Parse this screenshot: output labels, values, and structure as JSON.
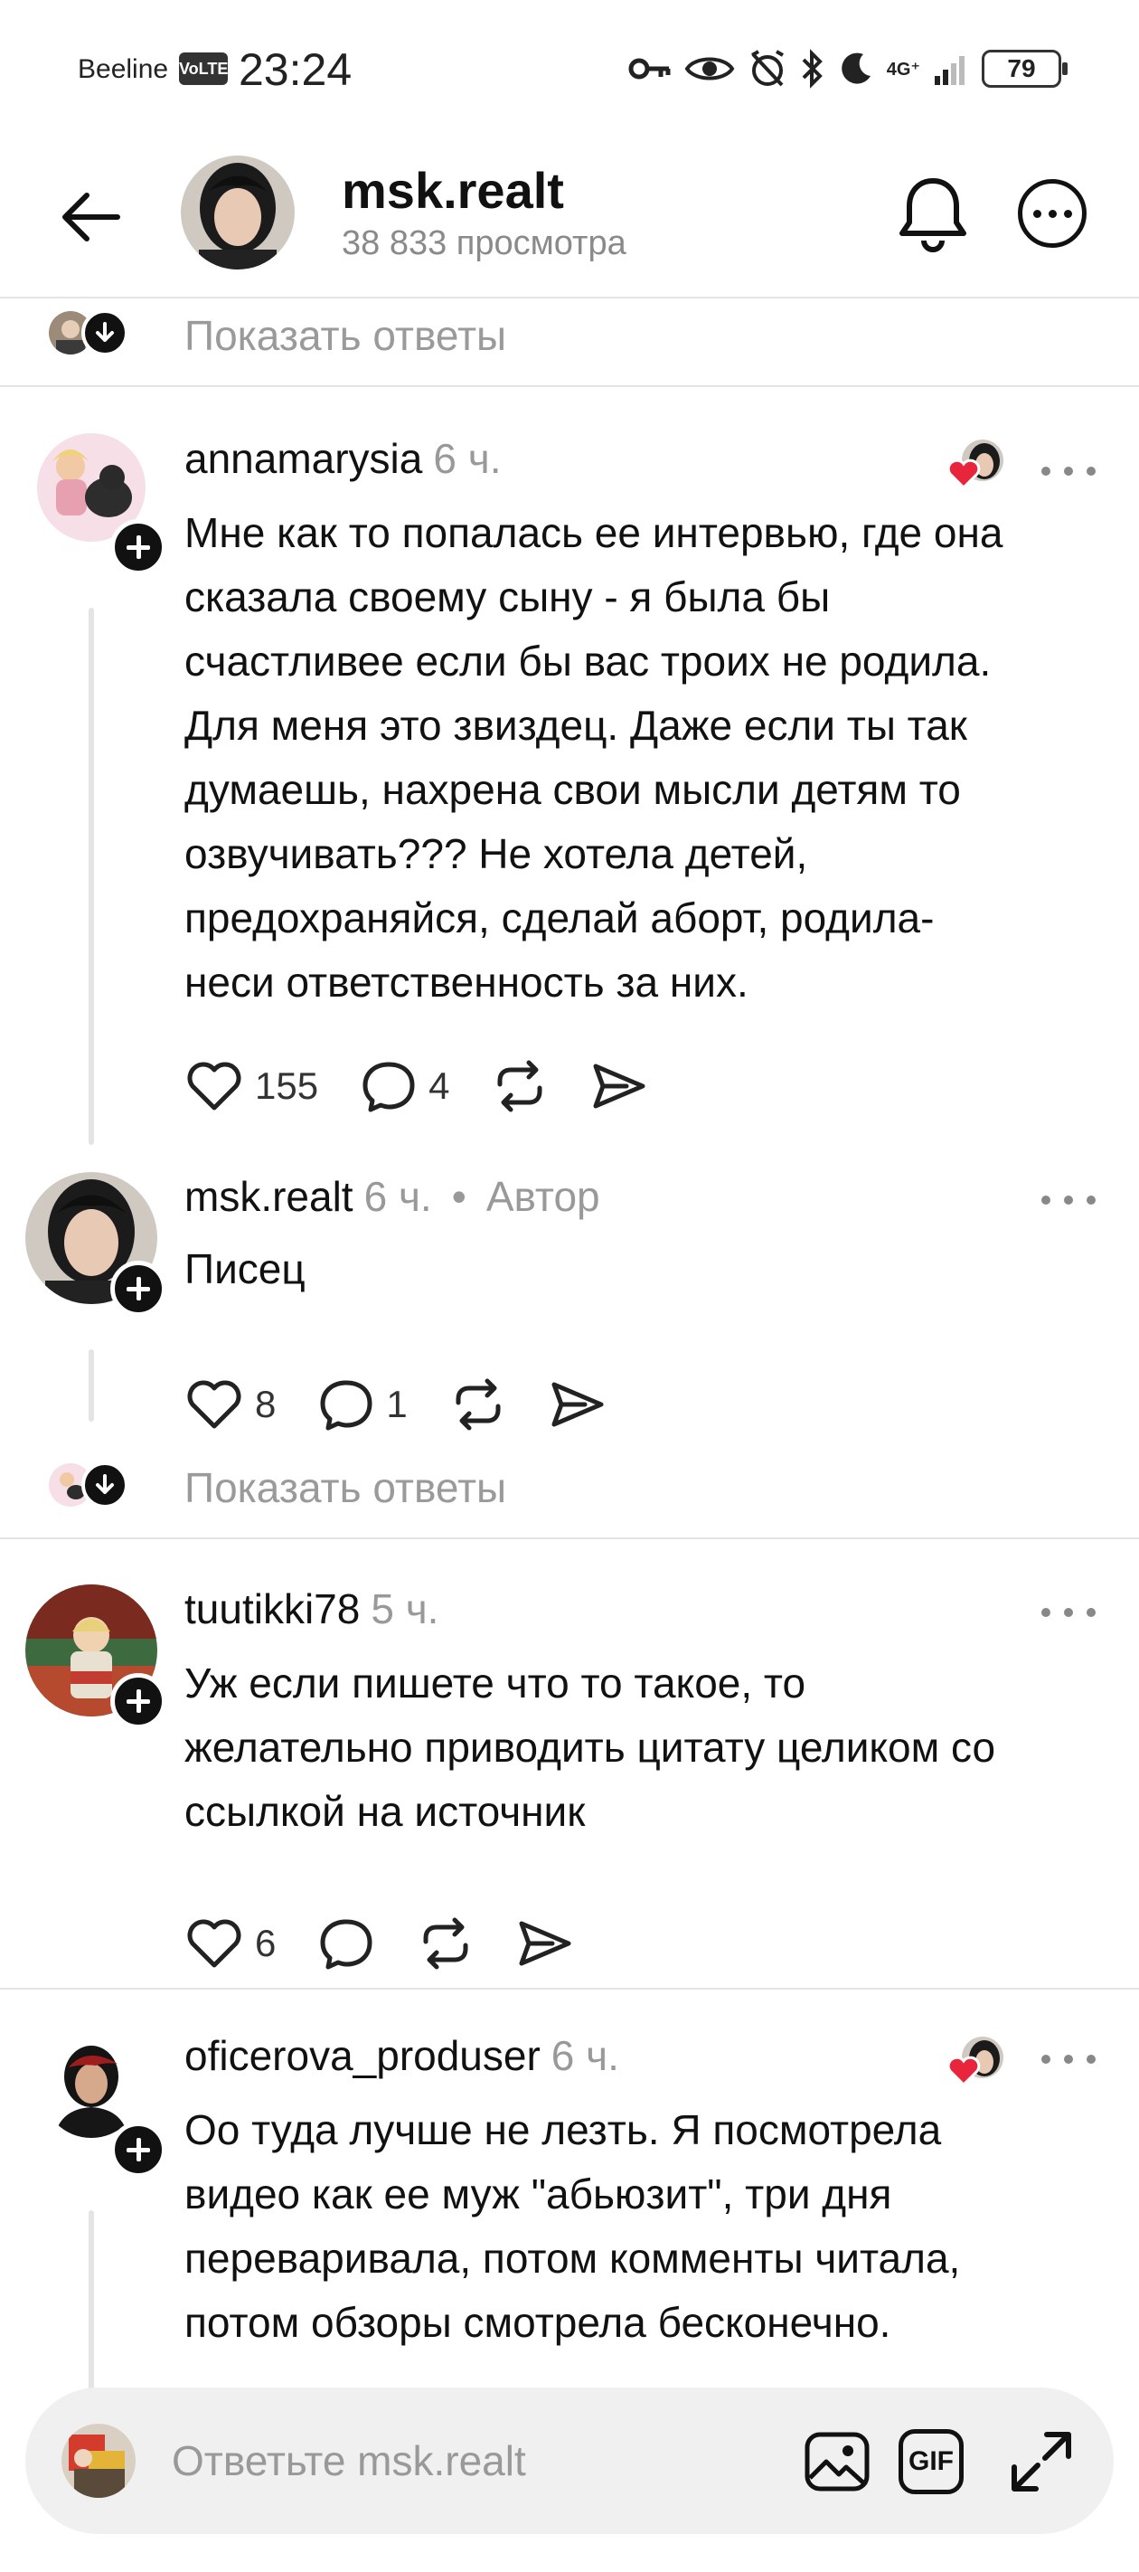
{
  "status_bar": {
    "carrier": "Beeline",
    "volte": "VoLTE",
    "time": "23:24",
    "network": "4G⁺",
    "battery": "79"
  },
  "header": {
    "title": "msk.realt",
    "subtitle": "38 833 просмотра"
  },
  "show_replies_label": "Показать ответы",
  "comments": [
    {
      "user": "annamarysia",
      "time": "6 ч.",
      "lines": [
        "Мне как то попалась ее интервью, где она",
        "сказала своему сыну - я была бы",
        "счастливее если бы вас троих не родила.",
        "Для меня это звиздец. Даже если ты так",
        "думаешь, нахрена свои мысли детям то",
        "озвучивать??? Не хотела детей,",
        "предохраняйся, сделай аборт, родила-",
        "неси ответственность за них."
      ],
      "likes": "155",
      "replies": "4"
    },
    {
      "user": "msk.realt",
      "time": "6 ч.",
      "author_label": "Автор",
      "lines": [
        "Писец"
      ],
      "likes": "8",
      "replies": "1"
    },
    {
      "user": "tuutikki78",
      "time": "5 ч.",
      "lines": [
        "Уж если пишете что то такое, то",
        "желательно приводить цитату целиком со",
        "ссылкой на источник"
      ],
      "likes": "6",
      "replies": ""
    },
    {
      "user": "oficerova_produser",
      "time": "6 ч.",
      "lines": [
        "Оо туда лучше не лезть. Я посмотрела",
        "видео как ее муж \"абьюзит\", три дня",
        "переваривала, потом комменты читала,",
        "потом обзоры смотрела бесконечно."
      ]
    }
  ],
  "reply_bar": {
    "placeholder": "Ответьте msk.realt",
    "gif_label": "GIF"
  },
  "colors": {
    "text": "#111111",
    "muted": "#999999",
    "heart": "#e8253a",
    "input_bg": "#f0f0f0"
  }
}
